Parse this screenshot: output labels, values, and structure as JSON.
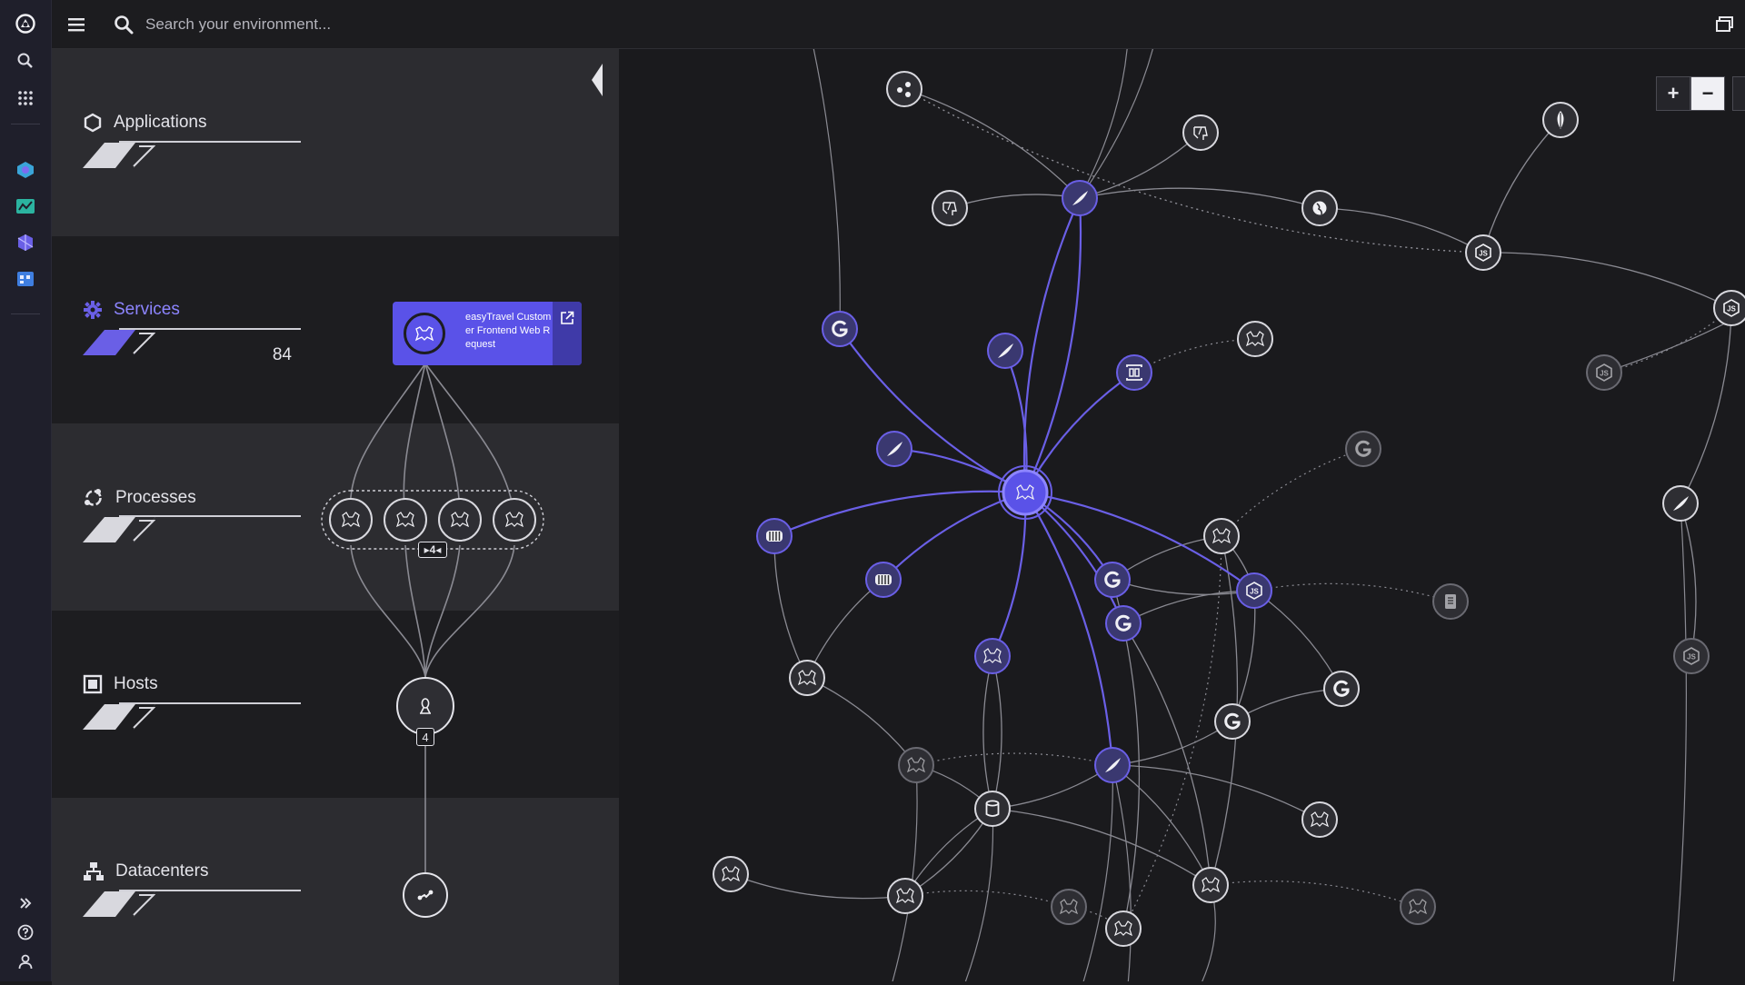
{
  "topbar": {
    "search_placeholder": "Search your environment..."
  },
  "rail_icons": [
    "dynatrace-logo-icon",
    "search-icon",
    "apps-grid-icon",
    "smartscape-icon",
    "dashboard-icon",
    "kubernetes-icon",
    "calendar-icon",
    "expand-icon",
    "help-icon",
    "user-icon"
  ],
  "tiers": {
    "applications": {
      "label": "Applications"
    },
    "services": {
      "label": "Services",
      "count": "84"
    },
    "processes": {
      "label": "Processes"
    },
    "hosts": {
      "label": "Hosts"
    },
    "datacenters": {
      "label": "Datacenters"
    }
  },
  "service_card": {
    "name": "easyTravel Customer Frontend Web Request"
  },
  "process_group": {
    "badge": "4"
  },
  "host_group": {
    "badge": "4"
  },
  "zoom": {
    "in_label": "+",
    "out_label": "−"
  },
  "colors": {
    "accent": "#5a52e8",
    "accent_light": "#8d85ff",
    "background": "#1a1a1d",
    "node_fill": "#2e2e33",
    "edge": "#8a8a92"
  },
  "graph": {
    "node_icons": [
      "share-icon",
      "feather-icon",
      "elephant-icon",
      "globe-icon",
      "nodejs-icon",
      "mongodb-icon",
      "nginx-icon",
      "go-icon",
      "tomcat-icon",
      "database-icon",
      "service-icon",
      "container-icon"
    ]
  }
}
